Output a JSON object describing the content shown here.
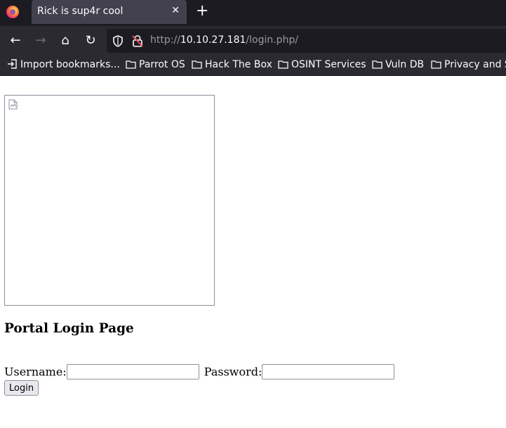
{
  "browser": {
    "tab": {
      "title": "Rick is sup4r cool",
      "close_glyph": "✕"
    },
    "new_tab_glyph": "+",
    "nav": {
      "back": "←",
      "forward": "→",
      "home": "⌂",
      "reload": "↻"
    },
    "url": {
      "scheme": "http://",
      "host": "10.10.27.181",
      "path": "/login.php/"
    },
    "bookmarks": [
      {
        "label": "Import bookmarks...",
        "icon": "import-icon"
      },
      {
        "label": "Parrot OS",
        "icon": "folder-icon"
      },
      {
        "label": "Hack The Box",
        "icon": "folder-icon"
      },
      {
        "label": "OSINT Services",
        "icon": "folder-icon"
      },
      {
        "label": "Vuln DB",
        "icon": "folder-icon"
      },
      {
        "label": "Privacy and S",
        "icon": "folder-icon"
      }
    ]
  },
  "page": {
    "heading": "Portal Login Page",
    "username_label": "Username:",
    "password_label": "Password:",
    "username_value": "",
    "password_value": "",
    "login_label": "Login"
  }
}
